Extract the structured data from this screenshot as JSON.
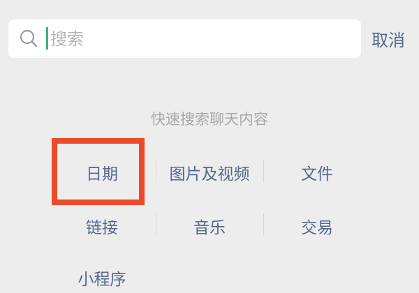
{
  "search": {
    "placeholder": "搜索",
    "value": "",
    "cancel_label": "取消"
  },
  "hint": "快速搜索聊天内容",
  "categories": [
    {
      "label": "日期"
    },
    {
      "label": "图片及视频"
    },
    {
      "label": "文件"
    },
    {
      "label": "链接"
    },
    {
      "label": "音乐"
    },
    {
      "label": "交易"
    },
    {
      "label": "小程序"
    }
  ],
  "colors": {
    "background": "#ededed",
    "link": "#57688d",
    "highlight": "#ec4a2a",
    "cursor": "#3cb371"
  },
  "icons": {
    "search": "search-icon"
  }
}
